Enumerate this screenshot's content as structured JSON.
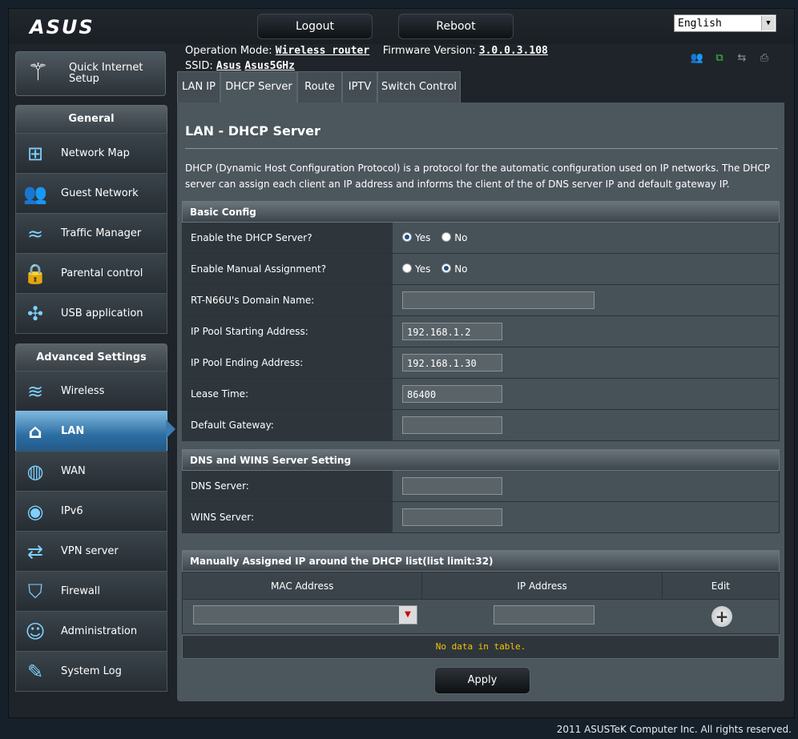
{
  "header": {
    "logo": "ASUS",
    "logout_label": "Logout",
    "reboot_label": "Reboot",
    "language": "English"
  },
  "info": {
    "operation_mode_label": "Operation Mode:",
    "operation_mode_value": "Wireless router",
    "firmware_label": "Firmware Version:",
    "firmware_value": "3.0.0.3.108",
    "ssid_label": "SSID:",
    "ssid_1": "Asus",
    "ssid_2": "Asus5GHz"
  },
  "status_icons": [
    "clients-icon",
    "network-icon",
    "usb-icon",
    "printer-icon"
  ],
  "quick_setup": {
    "label_line1": "Quick Internet",
    "label_line2": "Setup"
  },
  "sidebar": {
    "general_header": "General",
    "general_items": [
      {
        "label": "Network Map",
        "icon": "network-map-icon"
      },
      {
        "label": "Guest Network",
        "icon": "guest-network-icon"
      },
      {
        "label": "Traffic Manager",
        "icon": "traffic-manager-icon"
      },
      {
        "label": "Parental control",
        "icon": "lock-icon"
      },
      {
        "label": "USB application",
        "icon": "puzzle-icon"
      }
    ],
    "advanced_header": "Advanced Settings",
    "advanced_items": [
      {
        "label": "Wireless",
        "icon": "wifi-icon"
      },
      {
        "label": "LAN",
        "icon": "home-icon"
      },
      {
        "label": "WAN",
        "icon": "globe-icon"
      },
      {
        "label": "IPv6",
        "icon": "ipv6-icon"
      },
      {
        "label": "VPN server",
        "icon": "vpn-icon"
      },
      {
        "label": "Firewall",
        "icon": "shield-icon"
      },
      {
        "label": "Administration",
        "icon": "user-icon"
      },
      {
        "label": "System Log",
        "icon": "log-icon"
      }
    ],
    "active_item": "LAN"
  },
  "tabs": [
    {
      "label": "LAN IP"
    },
    {
      "label": "DHCP Server"
    },
    {
      "label": "Route"
    },
    {
      "label": "IPTV"
    },
    {
      "label": "Switch Control"
    }
  ],
  "main": {
    "title": "LAN - DHCP Server",
    "description": "DHCP (Dynamic Host Configuration Protocol) is a protocol for the automatic configuration used on IP networks. The DHCP server can assign each client an IP address and informs the client of the of DNS server IP and default gateway IP.",
    "basic_config": {
      "header": "Basic Config",
      "enable_dhcp_label": "Enable the DHCP Server?",
      "enable_dhcp_value": "Yes",
      "enable_manual_label": "Enable Manual Assignment?",
      "enable_manual_value": "No",
      "yes_label": "Yes",
      "no_label": "No",
      "domain_name_label": "RT-N66U's Domain Name:",
      "domain_name_value": "",
      "pool_start_label": "IP Pool Starting Address:",
      "pool_start_value": "192.168.1.2",
      "pool_end_label": "IP Pool Ending Address:",
      "pool_end_value": "192.168.1.30",
      "lease_time_label": "Lease Time:",
      "lease_time_value": "86400",
      "gateway_label": "Default Gateway:",
      "gateway_value": ""
    },
    "dns_wins": {
      "header": "DNS and WINS Server Setting",
      "dns_label": "DNS Server:",
      "dns_value": "",
      "wins_label": "WINS Server:",
      "wins_value": ""
    },
    "manual_list": {
      "header": "Manually Assigned IP around the DHCP list(list limit:32)",
      "col_mac": "MAC Address",
      "col_ip": "IP Address",
      "col_edit": "Edit",
      "empty_message": "No data in table."
    },
    "apply_label": "Apply"
  },
  "footer": "2011 ASUSTeK Computer Inc. All rights reserved."
}
